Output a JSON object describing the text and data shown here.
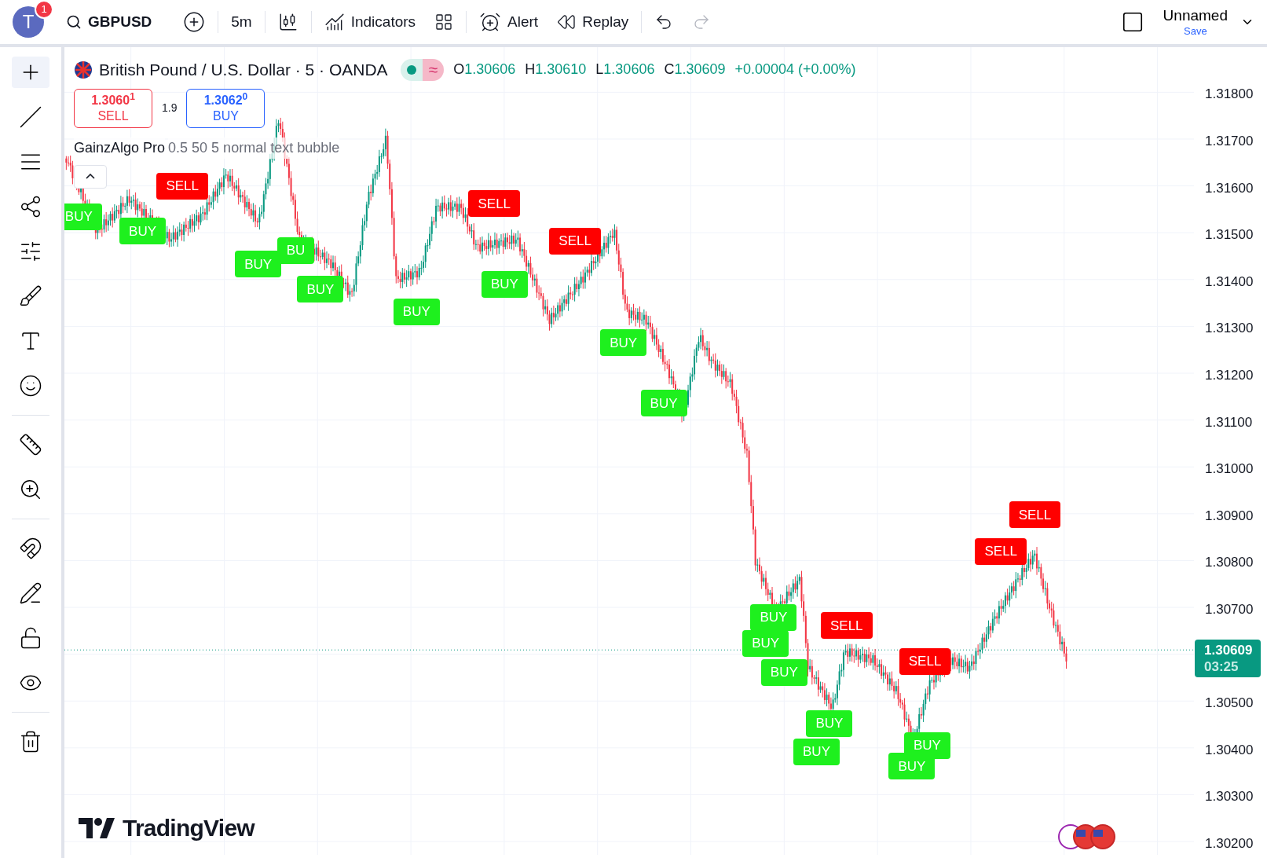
{
  "top_bar": {
    "avatar": "T",
    "notification_count": "1",
    "symbol": "GBPUSD",
    "interval": "5m",
    "indicators": "Indicators",
    "alert": "Alert",
    "replay": "Replay",
    "layout_name": "Unnamed",
    "save": "Save"
  },
  "legend": {
    "title": "British Pound / U.S. Dollar · 5 · OANDA",
    "pill_symbol": "≈",
    "ohlc": [
      {
        "letter": "O",
        "value": "1.30606"
      },
      {
        "letter": "H",
        "value": "1.30610"
      },
      {
        "letter": "L",
        "value": "1.30606"
      },
      {
        "letter": "C",
        "value": "1.30609"
      }
    ],
    "change": "+0.00004 (+0.00%)",
    "sell": {
      "price": "1.3060$^{1}$",
      "label": "SELL"
    },
    "spread": "1.9",
    "buy": {
      "price": "1.3062$^{0}$",
      "label": "BUY"
    },
    "indicator": {
      "name": "GainzAlgo Pro",
      "params": "0.5 50 5 normal text bubble"
    }
  },
  "signals": [
    {
      "kind": "buy",
      "label": "BUY"
    },
    {
      "kind": "sell",
      "label": "SELL"
    },
    {
      "kind": "buy",
      "label": "BUY"
    },
    {
      "kind": "buy",
      "label": "BUY"
    },
    {
      "kind": "buy",
      "label": "BU"
    },
    {
      "kind": "buy",
      "label": "BUY"
    },
    {
      "kind": "buy",
      "label": "BUY"
    },
    {
      "kind": "sell",
      "label": "SELL"
    },
    {
      "kind": "buy",
      "label": "BUY"
    },
    {
      "kind": "sell",
      "label": "SELL"
    },
    {
      "kind": "buy",
      "label": "BUY"
    },
    {
      "kind": "buy",
      "label": "BUY"
    },
    {
      "kind": "buy",
      "label": "BUY"
    },
    {
      "kind": "buy",
      "label": "BUY"
    },
    {
      "kind": "buy",
      "label": "BUY"
    },
    {
      "kind": "sell",
      "label": "SELL"
    },
    {
      "kind": "buy",
      "label": "BUY"
    },
    {
      "kind": "buy",
      "label": "BUY"
    },
    {
      "kind": "sell",
      "label": "SELL"
    },
    {
      "kind": "buy",
      "label": "BUY"
    },
    {
      "kind": "buy",
      "label": "BUY"
    },
    {
      "kind": "sell",
      "label": "SELL"
    },
    {
      "kind": "sell",
      "label": "SELL"
    }
  ],
  "price_axis": [
    "1.31800",
    "1.31700",
    "1.31600",
    "1.31500",
    "1.31400",
    "1.31300",
    "1.31200",
    "1.31100",
    "1.31000",
    "1.30900",
    "1.30800",
    "1.30700",
    "1.30500",
    "1.30400",
    "1.30300",
    "1.30200"
  ],
  "last_price": {
    "price": "1.30609",
    "countdown": "03:25"
  },
  "watermark_logo": "TradingView"
}
